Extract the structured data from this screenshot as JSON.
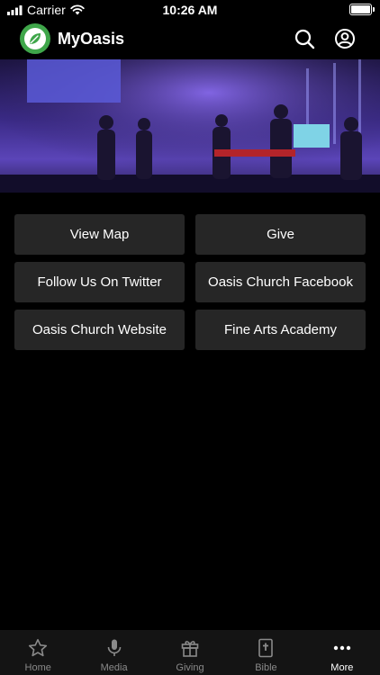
{
  "status_bar": {
    "carrier": "Carrier",
    "time": "10:26 AM"
  },
  "header": {
    "title": "MyOasis"
  },
  "buttons": [
    {
      "label": "View Map"
    },
    {
      "label": "Give"
    },
    {
      "label": "Follow Us On Twitter"
    },
    {
      "label": "Oasis Church Facebook"
    },
    {
      "label": "Oasis Church Website"
    },
    {
      "label": "Fine Arts Academy"
    }
  ],
  "tabs": [
    {
      "label": "Home",
      "icon": "star-icon",
      "active": false
    },
    {
      "label": "Media",
      "icon": "microphone-icon",
      "active": false
    },
    {
      "label": "Giving",
      "icon": "gift-icon",
      "active": false
    },
    {
      "label": "Bible",
      "icon": "bible-icon",
      "active": false
    },
    {
      "label": "More",
      "icon": "more-icon",
      "active": true
    }
  ],
  "colors": {
    "background": "#000000",
    "button_bg": "#262626",
    "logo_green": "#3fa64a",
    "tab_inactive": "#8a8a8a",
    "tab_active": "#ffffff"
  }
}
